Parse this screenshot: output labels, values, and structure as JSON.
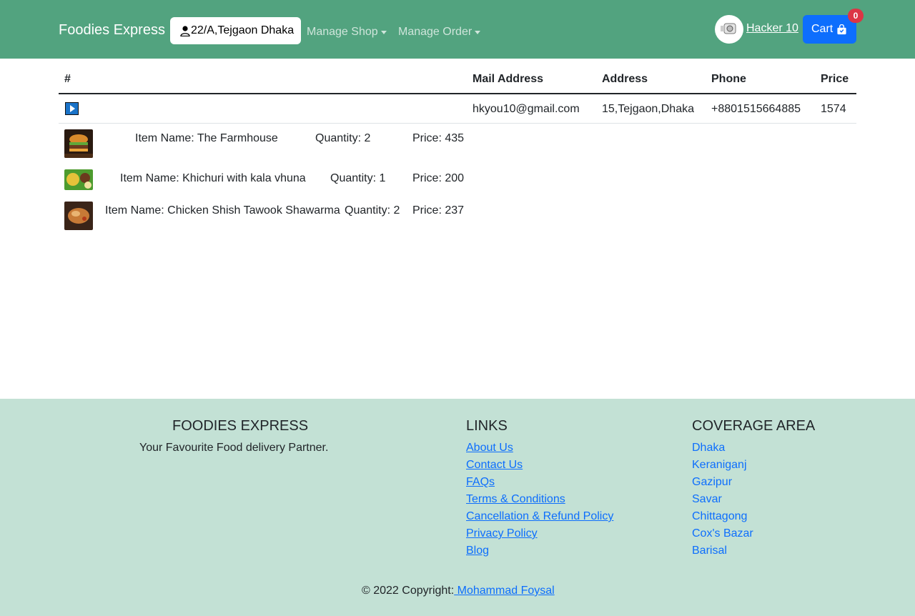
{
  "navbar": {
    "brand": "Foodies Express",
    "address": "22/A,Tejgaon Dhaka",
    "manage_shop": "Manage Shop",
    "manage_order": "Manage Order",
    "user_name": "Hacker 10",
    "cart_label": "Cart",
    "cart_count": "0",
    "bg_color": "#52a37f"
  },
  "table": {
    "headers": [
      "#",
      "Mail Address",
      "Address",
      "Phone",
      "Price"
    ],
    "order": {
      "mail": "hkyou10@gmail.com",
      "address": "15,Tejgaon,Dhaka",
      "phone": "+8801515664885",
      "price": "1574"
    },
    "items": [
      {
        "name": "Item Name: The Farmhouse",
        "quantity": "Quantity: 2",
        "price": "Price: 435"
      },
      {
        "name": "Item Name: Khichuri with kala vhuna",
        "quantity": "Quantity: 1",
        "price": "Price: 200"
      },
      {
        "name": "Item Name: Chicken Shish Tawook Shawarma",
        "quantity": "Quantity: 2",
        "price": "Price: 237"
      }
    ]
  },
  "footer": {
    "brand_title": "FOODIES EXPRESS",
    "tagline": "Your Favourite Food delivery Partner.",
    "links_title": "LINKS",
    "links": [
      "About Us",
      "Contact Us",
      "FAQs",
      "Terms & Conditions",
      "Cancellation & Refund Policy",
      "Privacy Policy",
      "Blog"
    ],
    "coverage_title": "COVERAGE AREA",
    "coverage": [
      "Dhaka",
      "Keraniganj",
      "Gazipur",
      "Savar",
      "Chittagong",
      "Cox's Bazar",
      "Barisal"
    ],
    "copyright_prefix": "© 2022 Copyright:",
    "copyright_author": " Mohammad Foysal",
    "bg_color": "#c3e1d5"
  }
}
